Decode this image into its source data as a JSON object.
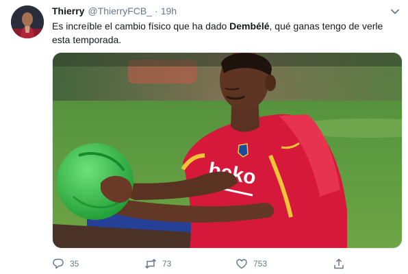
{
  "tweet": {
    "display_name": "Thierry",
    "handle": "@ThierryFCB_",
    "separator": "·",
    "time": "19h",
    "text_before": "Es increíble el cambio físico que ha dado ",
    "text_bold": "Dembélé",
    "text_after": ", qué ganas tengo de verle esta temporada.",
    "media_jersey_text": "beko"
  },
  "actions": {
    "replies": "35",
    "retweets": "73",
    "likes": "753"
  },
  "icons": {
    "reply": "reply-icon",
    "retweet": "retweet-icon",
    "like": "heart-icon",
    "share": "share-icon",
    "menu": "chevron-down-icon"
  },
  "colors": {
    "text_primary": "#14171a",
    "text_secondary": "#657786",
    "jersey_red": "#d6193a",
    "ball_green": "#35c24a"
  }
}
